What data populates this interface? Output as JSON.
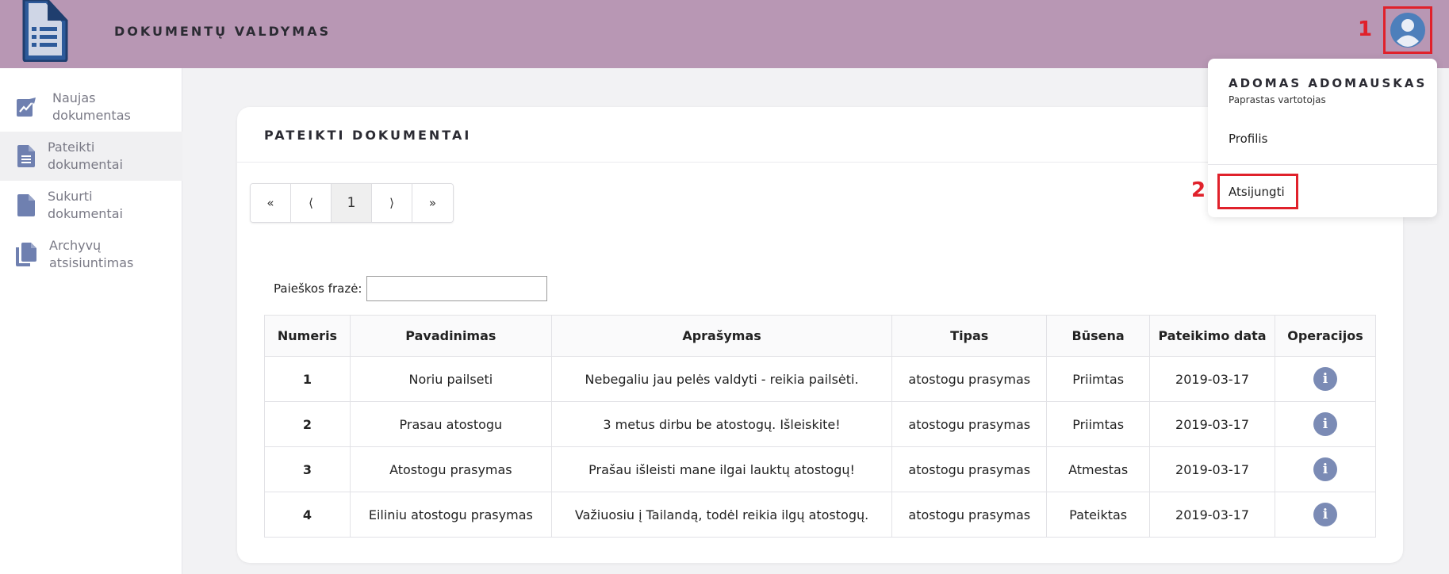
{
  "header": {
    "app_title": "DOKUMENTŲ VALDYMAS",
    "callout_1": "1",
    "callout_2": "2"
  },
  "sidebar": {
    "items": [
      {
        "label": "Naujas dokumentas",
        "icon": "new-document-icon",
        "active": false
      },
      {
        "label": "Pateikti dokumentai",
        "icon": "document-icon",
        "active": true
      },
      {
        "label": "Sukurti dokumentai",
        "icon": "file-icon",
        "active": false
      },
      {
        "label": "Archyvų atsisiuntimas",
        "icon": "archive-copy-icon",
        "active": false
      }
    ]
  },
  "card": {
    "title": "PATEIKTI DOKUMENTAI"
  },
  "pagination": {
    "first": "«",
    "prev": "⟨",
    "current": "1",
    "next": "⟩",
    "last": "»"
  },
  "search": {
    "label": "Paieškos frazė:",
    "value": ""
  },
  "table": {
    "headers": [
      "Numeris",
      "Pavadinimas",
      "Aprašymas",
      "Tipas",
      "Būsena",
      "Pateikimo data",
      "Operacijos"
    ],
    "rows": [
      {
        "number": "1",
        "name": "Noriu pailseti",
        "description": "Nebegaliu jau pelės valdyti - reikia pailsėti.",
        "type": "atostogu prasymas",
        "status": "Priimtas",
        "date": "2019-03-17"
      },
      {
        "number": "2",
        "name": "Prasau atostogu",
        "description": "3 metus dirbu be atostogų. Išleiskite!",
        "type": "atostogu prasymas",
        "status": "Priimtas",
        "date": "2019-03-17"
      },
      {
        "number": "3",
        "name": "Atostogu prasymas",
        "description": "Prašau išleisti mane ilgai lauktų atostogų!",
        "type": "atostogu prasymas",
        "status": "Atmestas",
        "date": "2019-03-17"
      },
      {
        "number": "4",
        "name": "Eiliniu atostogu prasymas",
        "description": "Važiuosiu į Tailandą, todėl reikia ilgų atostogų.",
        "type": "atostogu prasymas",
        "status": "Pateiktas",
        "date": "2019-03-17"
      }
    ],
    "info_glyph": "i"
  },
  "user_menu": {
    "name": "ADOMAS ADOMAUSKAS",
    "role": "Paprastas vartotojas",
    "profile_label": "Profilis",
    "logout_label": "Atsijungti"
  },
  "colors": {
    "header_bg": "#b897b4",
    "accent_icon": "#6f80b0",
    "highlight": "#e0212b",
    "info_button": "#7b8bb5"
  }
}
